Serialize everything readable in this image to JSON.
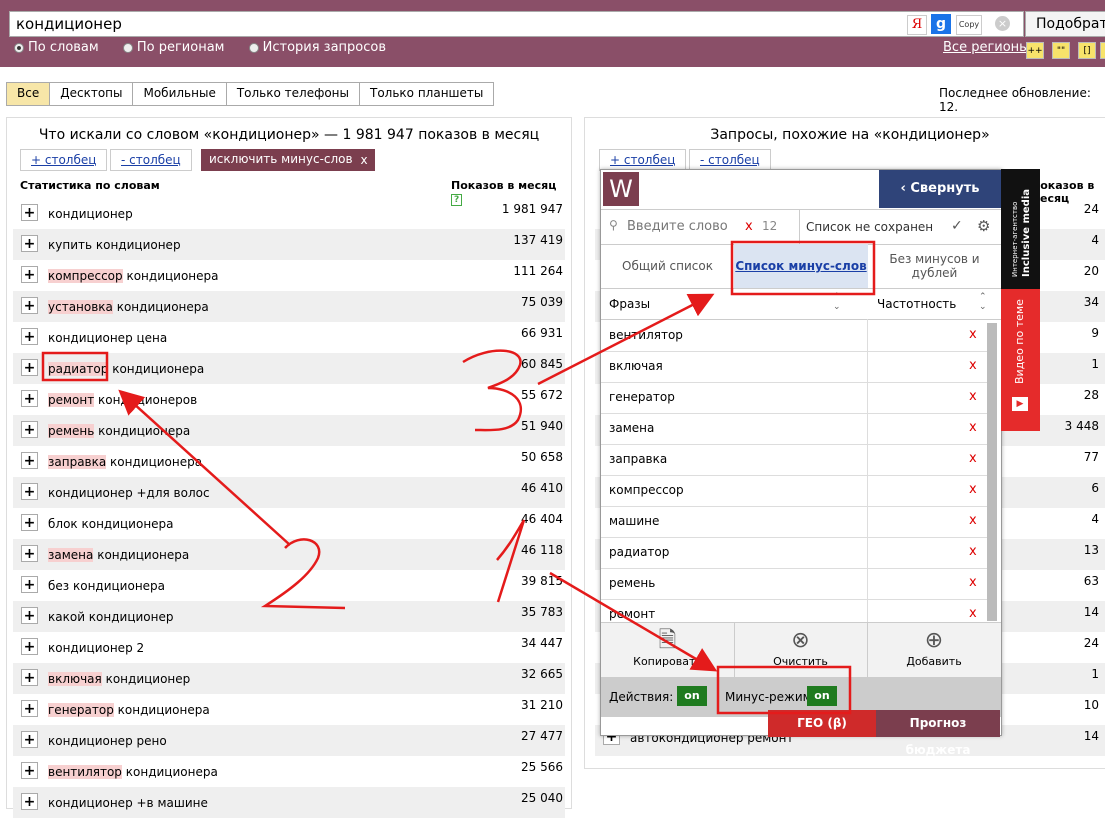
{
  "search": {
    "query": "кондиционер",
    "ya": "Я",
    "g": "g",
    "copy": "Copy",
    "clear": "⊗",
    "submit": "Подобрать"
  },
  "modes": [
    "По словам",
    "По регионам",
    "История запросов"
  ],
  "regions_link": "Все регионы",
  "mini_buttons": [
    "++",
    "\"\"",
    "[]",
    "!"
  ],
  "device_tabs": [
    "Все",
    "Десктопы",
    "Мобильные",
    "Только телефоны",
    "Только планшеты"
  ],
  "last_update": "Последнее обновление: 12.",
  "left": {
    "title": "Что искали со словом «кондиционер» — 1 981 947 показов в месяц",
    "add_col": "+ столбец",
    "remove_col": "- столбец",
    "exclude": "исключить минус-слова",
    "close": "x",
    "head_stat": "Статистика по словам",
    "head_count": "Показов в месяц",
    "help_icon": "?",
    "rows": [
      {
        "hl": "",
        "rest": "кондиционер",
        "n": "1 981 947"
      },
      {
        "hl": "",
        "rest": "купить кондиционер",
        "n": "137 419"
      },
      {
        "hl": "компрессор",
        "rest": " кондиционера",
        "n": "111 264"
      },
      {
        "hl": "установка",
        "rest": " кондиционера",
        "n": "75 039"
      },
      {
        "hl": "",
        "rest": "кондиционер цена",
        "n": "66 931"
      },
      {
        "hl": "радиатор",
        "rest": " кондиционера",
        "n": "60 845"
      },
      {
        "hl": "ремонт",
        "rest": " кондиционеров",
        "n": "55 672"
      },
      {
        "hl": "ремень",
        "rest": " кондиционера",
        "n": "51 940"
      },
      {
        "hl": "заправка",
        "rest": " кондиционера",
        "n": "50 658"
      },
      {
        "hl": "",
        "rest": "кондиционер +для волос",
        "n": "46 410"
      },
      {
        "hl": "",
        "rest": "блок кондиционера",
        "n": "46 404"
      },
      {
        "hl": "замена",
        "rest": " кондиционера",
        "n": "46 118"
      },
      {
        "hl": "",
        "rest": "без кондиционера",
        "n": "39 815"
      },
      {
        "hl": "",
        "rest": "какой кондиционер",
        "n": "35 783"
      },
      {
        "hl": "",
        "rest": "кондиционер 2",
        "n": "34 447"
      },
      {
        "hl": "включая",
        "rest": " кондиционер",
        "n": "32 665"
      },
      {
        "hl": "генератор",
        "rest": " кондиционера",
        "n": "31 210"
      },
      {
        "hl": "",
        "rest": "кондиционер рено",
        "n": "27 477"
      },
      {
        "hl": "вентилятор",
        "rest": " кондиционера",
        "n": "25 566"
      },
      {
        "hl": "",
        "rest": "кондиционер +в машине",
        "n": "25 040"
      }
    ]
  },
  "right": {
    "title": "Запросы, похожие на «кондиционер»",
    "add_col": "+ столбец",
    "remove_col": "- столбец",
    "head_count": "Показов в месяц",
    "numbers": [
      "24",
      "4",
      "20",
      "34",
      "9",
      "1",
      "28",
      "3 448",
      "77",
      "6",
      "4",
      "13",
      "63",
      "14",
      "24",
      "1",
      "10",
      "14"
    ],
    "last_row": "автокондиционер ремонт"
  },
  "widget": {
    "logo": "W",
    "collapse": "‹ Свернуть",
    "search_placeholder": "Введите слово",
    "clear_x": "x",
    "count": "12",
    "saved": "Список не сохранен",
    "tabs": [
      "Общий список",
      "Список минус-слов",
      "Без минусов и дублей"
    ],
    "th_phrases": "Фразы",
    "th_freq": "Частотность",
    "words": [
      "вентилятор",
      "включая",
      "генератор",
      "замена",
      "заправка",
      "компрессор",
      "машине",
      "радиатор",
      "ремень",
      "ремонт"
    ],
    "del": "x",
    "actions": [
      "Копировать",
      "Очистить",
      "Добавить"
    ],
    "footer_actions": "Действия:",
    "footer_minus": "Минус-режим",
    "on": "on",
    "geo": "ГЕО (β)",
    "budget": "Прогноз бюджета",
    "side_agency": "Интернет-агентство",
    "side_brand": "Inclusive media",
    "side_video": "Видео по теме"
  },
  "annotations": [
    "1",
    "2",
    "3"
  ]
}
